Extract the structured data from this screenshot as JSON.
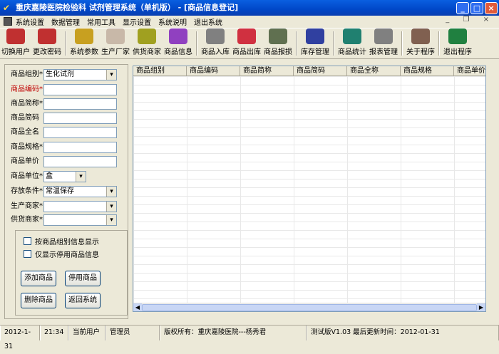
{
  "window": {
    "title": "重庆嘉陵医院检验科 试剂管理系统（单机版） - [商品信息登记]",
    "min": "_",
    "max": "□",
    "close": "×"
  },
  "menu": [
    "系统设置",
    "数据管理",
    "常用工具",
    "显示设置",
    "系统说明",
    "退出系统"
  ],
  "mdi_controls": "_ ❐ ×",
  "toolbar": [
    {
      "label": "切换用户",
      "color": "#c03030"
    },
    {
      "label": "更改密码",
      "color": "#c03030"
    },
    {
      "sep": true
    },
    {
      "label": "系统参数",
      "color": "#c8a020"
    },
    {
      "label": "生产厂家",
      "color": "#c8b8a8"
    },
    {
      "label": "供货商家",
      "color": "#a0a020"
    },
    {
      "label": "商品信息",
      "color": "#9040c0"
    },
    {
      "sep": true
    },
    {
      "label": "商品入库",
      "color": "#808080"
    },
    {
      "label": "商品出库",
      "color": "#d03040"
    },
    {
      "label": "商品报损",
      "color": "#607050"
    },
    {
      "sep": true
    },
    {
      "label": "库存管理",
      "color": "#3040a0"
    },
    {
      "sep": true
    },
    {
      "label": "商品统计",
      "color": "#208070"
    },
    {
      "label": "报表管理",
      "color": "#808080"
    },
    {
      "sep": true
    },
    {
      "label": "关于程序",
      "color": "#806050"
    },
    {
      "sep": true
    },
    {
      "label": "退出程序",
      "color": "#208040"
    }
  ],
  "form": {
    "fields": [
      {
        "label": "商品组别*",
        "value": "生化试剂",
        "dropdown": true
      },
      {
        "label": "商品编码*",
        "value": "",
        "red": true
      },
      {
        "label": "商品简称*",
        "value": ""
      },
      {
        "label": "商品简码",
        "value": ""
      },
      {
        "label": "商品全名",
        "value": ""
      },
      {
        "label": "商品规格*",
        "value": ""
      },
      {
        "label": "商品单价",
        "value": ""
      },
      {
        "label": "商品单位*",
        "value": "盒",
        "dropdown": true,
        "short": true
      },
      {
        "label": "存放条件*",
        "value": "常温保存",
        "dropdown": true
      },
      {
        "label": "生产商家*",
        "value": "",
        "dropdown": true
      },
      {
        "label": "供货商家*",
        "value": "",
        "dropdown": true
      }
    ],
    "checkbox1": "按商品组别信息显示",
    "checkbox2": "仅显示停用商品信息",
    "add": "添加商品",
    "disable": "停用商品",
    "delete": "删除商品",
    "back": "返回系统"
  },
  "grid": {
    "columns": [
      "商品组别",
      "商品编码",
      "商品简称",
      "商品简码",
      "商品全称",
      "商品规格",
      "商品单价"
    ]
  },
  "status": {
    "date": "2012-1-31",
    "time": "21:34",
    "user_label": "当前用户",
    "user": "管理员",
    "copyright": "版权所有：重庆嘉陵医院---杨秀君",
    "version": "测试版V1.03 最后更新时间：2012-01-31"
  }
}
